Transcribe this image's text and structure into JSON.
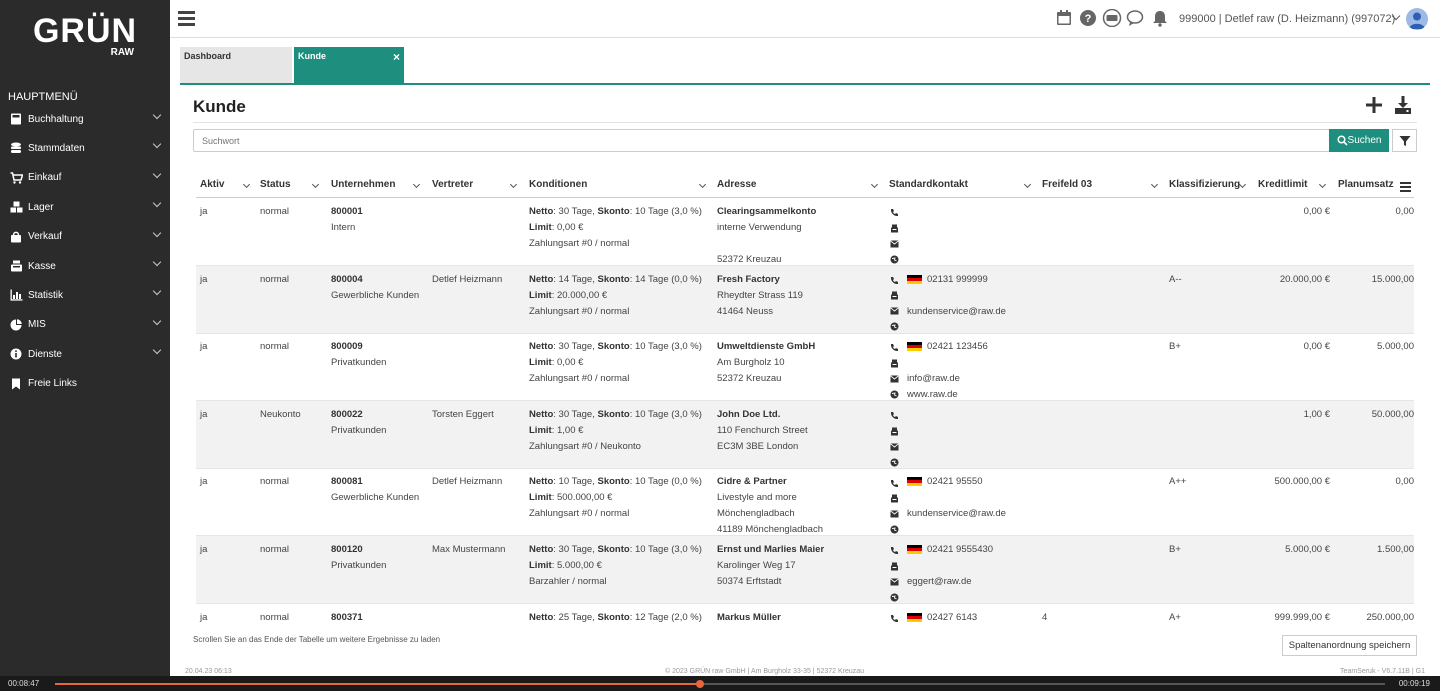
{
  "brand": {
    "name": "GRÜN",
    "sub": "RAW"
  },
  "sidebar": {
    "heading": "HAUPTMENÜ",
    "items": [
      {
        "label": "Buchhaltung",
        "icon": "calculator-icon",
        "chevron": true
      },
      {
        "label": "Stammdaten",
        "icon": "database-icon",
        "chevron": true
      },
      {
        "label": "Einkauf",
        "icon": "cart-icon",
        "chevron": true
      },
      {
        "label": "Lager",
        "icon": "boxes-icon",
        "chevron": true
      },
      {
        "label": "Verkauf",
        "icon": "shopping-bag-icon",
        "chevron": true
      },
      {
        "label": "Kasse",
        "icon": "cash-register-icon",
        "chevron": true
      },
      {
        "label": "Statistik",
        "icon": "bar-chart-icon",
        "chevron": true
      },
      {
        "label": "MIS",
        "icon": "pie-chart-icon",
        "chevron": true
      },
      {
        "label": "Dienste",
        "icon": "info-icon",
        "chevron": true
      },
      {
        "label": "Freie Links",
        "icon": "bookmark-icon",
        "chevron": false
      }
    ]
  },
  "topbar": {
    "user": "999000 | Detlef raw (D. Heizmann) (997072)"
  },
  "tabs": [
    {
      "label": "Dashboard"
    },
    {
      "label": "Kunde",
      "close": "×"
    }
  ],
  "page": {
    "title": "Kunde"
  },
  "search": {
    "placeholder": "Suchwort",
    "button_label": "Suchen"
  },
  "table": {
    "columns": [
      "Aktiv",
      "Status",
      "Unternehmen",
      "Vertreter",
      "Konditionen",
      "Adresse",
      "Standardkontakt",
      "Freifeld 03",
      "Klassifizierung",
      "Kreditlimit",
      "Planumsatz"
    ],
    "labels": {
      "netto": "Netto",
      "skonto": "Skonto",
      "limit": "Limit"
    },
    "rows": [
      {
        "aktiv": "ja",
        "status": "normal",
        "nr": "800001",
        "gruppe": "Intern",
        "vertreter": "",
        "netto": ": 30 Tage, ",
        "skonto": ": 10 Tage  (3,0 %)",
        "limit": ": 0,00 €",
        "zahlungsart": "Zahlungsart #0 / normal",
        "adresse": [
          "Clearingsammelkonto",
          "interne Verwendung",
          "",
          "52372 Kreuzau"
        ],
        "phone": "",
        "email": "",
        "web": "",
        "freifeld": "",
        "klass": "",
        "kredit": "0,00 €",
        "plan": "0,00"
      },
      {
        "aktiv": "ja",
        "status": "normal",
        "nr": "800004",
        "gruppe": "Gewerbliche Kunden",
        "vertreter": "Detlef Heizmann",
        "netto": ": 14 Tage, ",
        "skonto": ": 14 Tage  (0,0 %)",
        "limit": ": 20.000,00 €",
        "zahlungsart": "Zahlungsart #0 / normal",
        "adresse": [
          "Fresh Factory",
          "Rheydter Strass 119",
          "41464 Neuss",
          ""
        ],
        "phone": "02131 999999",
        "email": "kundenservice@raw.de",
        "web": "",
        "freifeld": "",
        "klass": "A--",
        "kredit": "20.000,00 €",
        "plan": "15.000,00"
      },
      {
        "aktiv": "ja",
        "status": "normal",
        "nr": "800009",
        "gruppe": "Privatkunden",
        "vertreter": "",
        "netto": ": 30 Tage, ",
        "skonto": ": 10 Tage  (3,0 %)",
        "limit": ": 0,00 €",
        "zahlungsart": "Zahlungsart #0 / normal",
        "adresse": [
          "Umweltdienste GmbH",
          "Am Burgholz 10",
          "52372 Kreuzau",
          ""
        ],
        "phone": "02421 123456",
        "email": "info@raw.de",
        "web": "www.raw.de",
        "freifeld": "",
        "klass": "B+",
        "kredit": "0,00 €",
        "plan": "5.000,00"
      },
      {
        "aktiv": "ja",
        "status": "Neukonto",
        "nr": "800022",
        "gruppe": "Privatkunden",
        "vertreter": "Torsten Eggert",
        "netto": ": 30 Tage, ",
        "skonto": ": 10 Tage  (3,0 %)",
        "limit": ": 1,00 €",
        "zahlungsart": "Zahlungsart #0 / Neukonto",
        "adresse": [
          "John Doe Ltd.",
          "110 Fenchurch Street",
          "EC3M 3BE London",
          ""
        ],
        "phone": "",
        "email": "",
        "web": "",
        "freifeld": "",
        "klass": "",
        "kredit": "1,00 €",
        "plan": "50.000,00"
      },
      {
        "aktiv": "ja",
        "status": "normal",
        "nr": "800081",
        "gruppe": "Gewerbliche Kunden",
        "vertreter": "Detlef Heizmann",
        "netto": ": 10 Tage, ",
        "skonto": ": 10 Tage  (0,0 %)",
        "limit": ": 500.000,00 €",
        "zahlungsart": "Zahlungsart #0 / normal",
        "adresse": [
          "Cidre & Partner",
          "Livestyle and more",
          "Mönchengladbach",
          "41189 Mönchengladbach"
        ],
        "phone": "02421 95550",
        "email": "kundenservice@raw.de",
        "web": "",
        "freifeld": "",
        "klass": "A++",
        "kredit": "500.000,00 €",
        "plan": "0,00"
      },
      {
        "aktiv": "ja",
        "status": "normal",
        "nr": "800120",
        "gruppe": "Privatkunden",
        "vertreter": "Max Mustermann",
        "netto": ": 30 Tage, ",
        "skonto": ": 10 Tage  (3,0 %)",
        "limit": ": 5.000,00 €",
        "zahlungsart": "Barzahler / normal",
        "adresse": [
          "Ernst und Marlies Maier",
          "Karolinger Weg 17",
          "50374 Erftstadt",
          ""
        ],
        "phone": "02421 9555430",
        "email": "eggert@raw.de",
        "web": "",
        "freifeld": "",
        "klass": "B+",
        "kredit": "5.000,00 €",
        "plan": "1.500,00"
      },
      {
        "aktiv": "ja",
        "status": "normal",
        "nr": "800371",
        "gruppe": "",
        "vertreter": "",
        "netto": ": 25 Tage, ",
        "skonto": ": 12 Tage  (2,0 %)",
        "limit": "",
        "zahlungsart": "",
        "adresse": [
          "Markus Müller",
          "",
          "",
          ""
        ],
        "phone": "02427 6143",
        "email": "",
        "web": "",
        "freifeld": "4",
        "klass": "A+",
        "kredit": "999.999,00 €",
        "plan": "250.000,00"
      }
    ]
  },
  "footer": {
    "hint": "Scrollen Sie an das Ende der Tabelle um weitere Ergebnisse zu laden",
    "save_label": "Spaltenanordnung speichern"
  },
  "copyright": {
    "left": "20.04.23 06:13",
    "center": "© 2023 GRÜN raw GmbH | Am Burgholz 33-35 | 52372 Kreuzau",
    "right": "TeamSeruk - V6.7.11B | G1"
  },
  "player": {
    "current": "00:08:47",
    "total": "00:09:19",
    "progress": 0.485
  }
}
